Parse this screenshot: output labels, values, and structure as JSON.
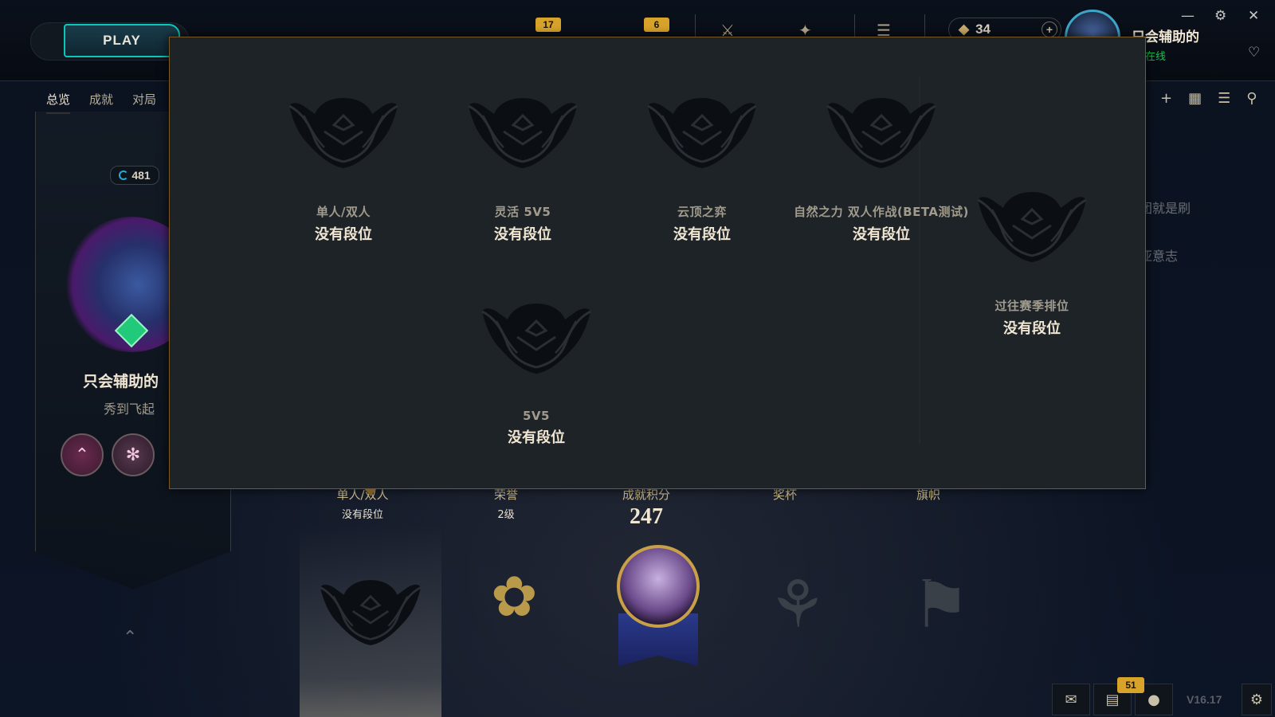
{
  "header": {
    "play_label": "PLAY",
    "badge_left": "17",
    "badge_right": "6",
    "currency_value": "34",
    "currency_add": "+",
    "summoner_name": "只会辅助的",
    "status": "在线"
  },
  "subnav": {
    "tabs": [
      "总览",
      "成就",
      "对局"
    ]
  },
  "profile": {
    "level": "481",
    "name": "只会辅助的",
    "title": "秀到飞起"
  },
  "stats": [
    {
      "label": "单人/双人",
      "sub": "没有段位"
    },
    {
      "label": "荣誉",
      "sub": "2级"
    },
    {
      "label": "成就积分",
      "sub": "247"
    },
    {
      "label": "奖杯",
      "sub": ""
    },
    {
      "label": "旗帜",
      "sub": ""
    }
  ],
  "side_texts": [
    "团就是刷",
    "亚意志"
  ],
  "rank_popup": {
    "items": [
      {
        "queue": "单人/双人",
        "tier": "没有段位"
      },
      {
        "queue": "灵活 5V5",
        "tier": "没有段位"
      },
      {
        "queue": "云顶之弈",
        "tier": "没有段位"
      },
      {
        "queue": "自然之力 双人作战(BETA测试)",
        "tier": "没有段位"
      },
      {
        "queue": "5V5",
        "tier": "没有段位"
      },
      {
        "queue": "过往赛季排位",
        "tier": "没有段位"
      }
    ]
  },
  "footer": {
    "notification_count": "51",
    "version": "V16.17"
  },
  "colors": {
    "gold": "#c8aa6e",
    "popup_bg": "#1e2328",
    "popup_border": "#785a28",
    "accent_teal": "#0ac8b9",
    "online_green": "#1bbf4e"
  },
  "icons": [
    "wings-rank-icon",
    "honor-icon",
    "trophy-icon",
    "banner-icon",
    "chat-icon",
    "mic-icon",
    "settings-icon",
    "bell-icon"
  ]
}
